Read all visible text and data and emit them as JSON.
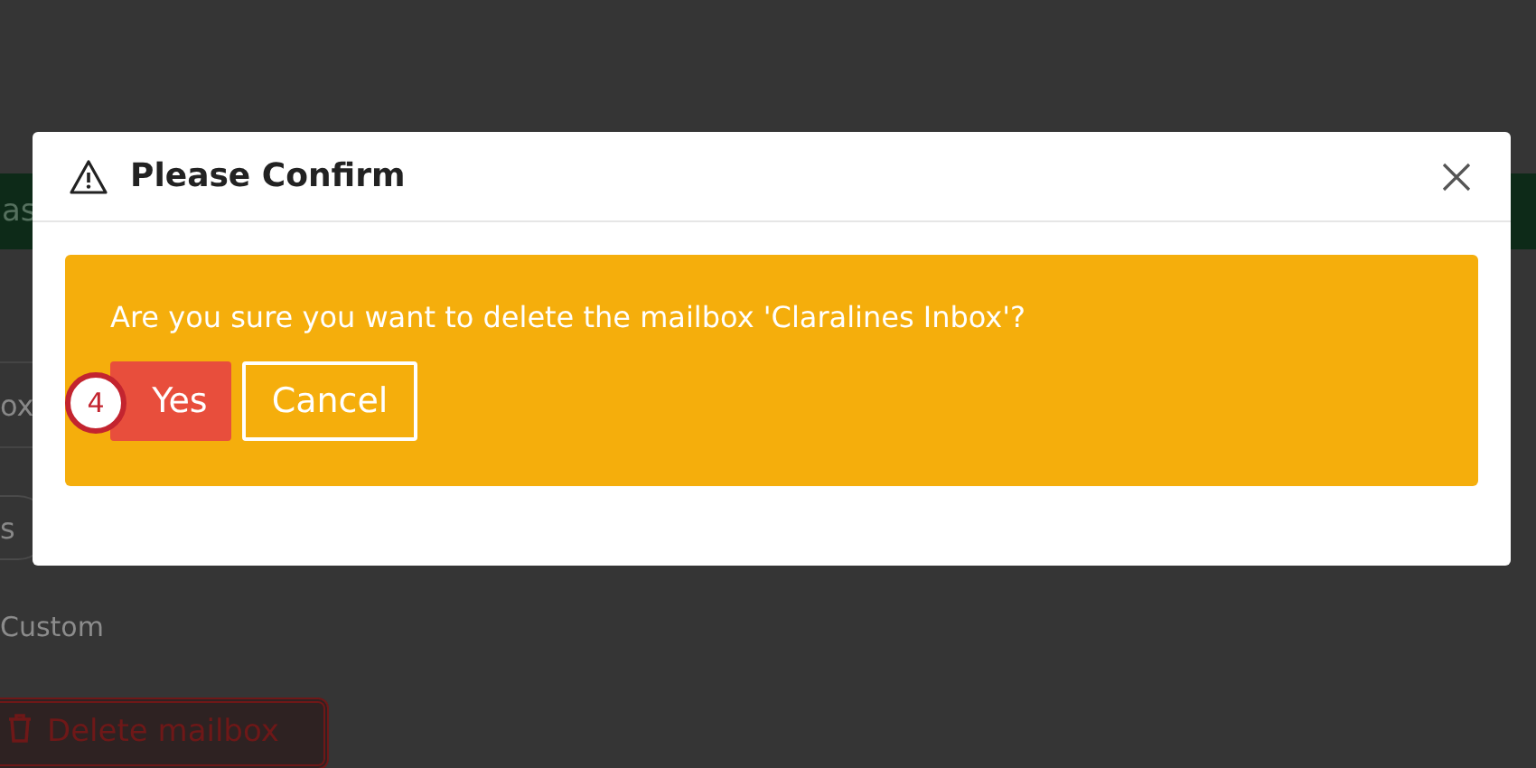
{
  "background": {
    "banner_text": "as",
    "field_text": "ox",
    "pill_text": "s",
    "option_text": "Custom",
    "delete_button": "Delete mailbox"
  },
  "dialog": {
    "title": "Please Confirm",
    "message": "Are you sure you want to delete the mailbox 'Claralines Inbox'?",
    "buttons": [
      {
        "label": "Yes",
        "kind": "primary"
      },
      {
        "label": "Cancel",
        "kind": "secondary"
      }
    ],
    "step_badge": "4"
  }
}
